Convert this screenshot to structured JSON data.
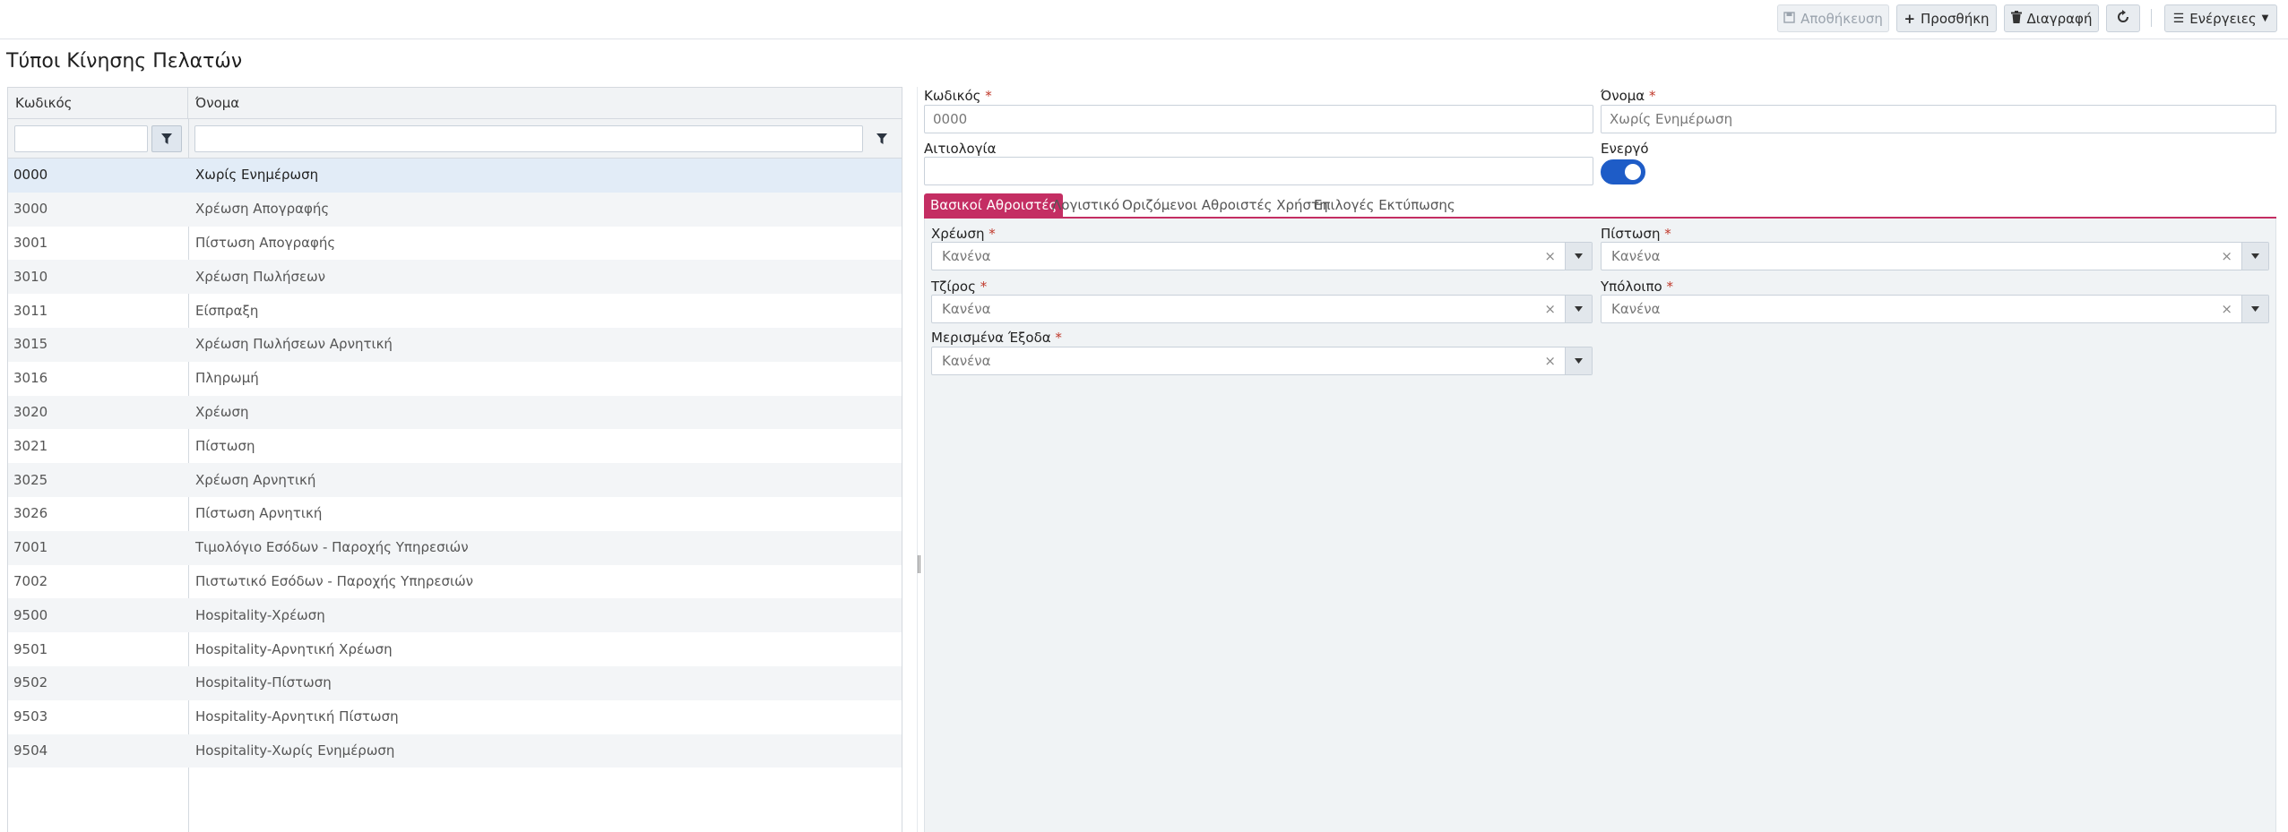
{
  "toolbar": {
    "save_label": "Αποθήκευση",
    "add_label": "Προσθήκη",
    "delete_label": "Διαγραφή",
    "actions_label": "Ενέργειες"
  },
  "page_title": "Τύποι Κίνησης Πελατών",
  "grid": {
    "columns": [
      "Κωδικός",
      "Όνομα"
    ],
    "rows": [
      {
        "code": "0000",
        "name": "Χωρίς Ενημέρωση"
      },
      {
        "code": "3000",
        "name": "Χρέωση Απογραφής"
      },
      {
        "code": "3001",
        "name": "Πίστωση Απογραφής"
      },
      {
        "code": "3010",
        "name": "Χρέωση Πωλήσεων"
      },
      {
        "code": "3011",
        "name": "Είσπραξη"
      },
      {
        "code": "3015",
        "name": "Χρέωση Πωλήσεων Αρνητική"
      },
      {
        "code": "3016",
        "name": "Πληρωμή"
      },
      {
        "code": "3020",
        "name": "Χρέωση"
      },
      {
        "code": "3021",
        "name": "Πίστωση"
      },
      {
        "code": "3025",
        "name": "Χρέωση Αρνητική"
      },
      {
        "code": "3026",
        "name": "Πίστωση Αρνητική"
      },
      {
        "code": "7001",
        "name": "Τιμολόγιο Εσόδων - Παροχής Υπηρεσιών"
      },
      {
        "code": "7002",
        "name": "Πιστωτικό Εσόδων - Παροχής Υπηρεσιών"
      },
      {
        "code": "9500",
        "name": "Hospitality-Χρέωση"
      },
      {
        "code": "9501",
        "name": "Hospitality-Αρνητική Χρέωση"
      },
      {
        "code": "9502",
        "name": "Hospitality-Πίστωση"
      },
      {
        "code": "9503",
        "name": "Hospitality-Αρνητική Πίστωση"
      },
      {
        "code": "9504",
        "name": "Hospitality-Χωρίς Ενημέρωση"
      }
    ]
  },
  "form": {
    "code_label": "Κωδικός",
    "code_value": "0000",
    "name_label": "Όνομα",
    "name_value": "Χωρίς Ενημέρωση",
    "reason_label": "Αιτιολογία",
    "reason_value": "",
    "active_label": "Ενεργό",
    "active": true,
    "required_mark": "*"
  },
  "tabs": [
    "Βασικοί Αθροιστές",
    "Λογιστικό",
    "Οριζόμενοι Αθροιστές Χρήστη",
    "Επιλογές Εκτύπωσης"
  ],
  "fields": {
    "debit_label": "Χρέωση",
    "credit_label": "Πίστωση",
    "turnover_label": "Τζίρος",
    "balance_label": "Υπόλοιπο",
    "deferred_label": "Μερισμένα Έξοδα",
    "none_value": "Κανένα",
    "clear_glyph": "×"
  },
  "colors": {
    "accent": "#c42e63",
    "toggle": "#1e5cc7",
    "selected_row": "#e2ecf7"
  }
}
